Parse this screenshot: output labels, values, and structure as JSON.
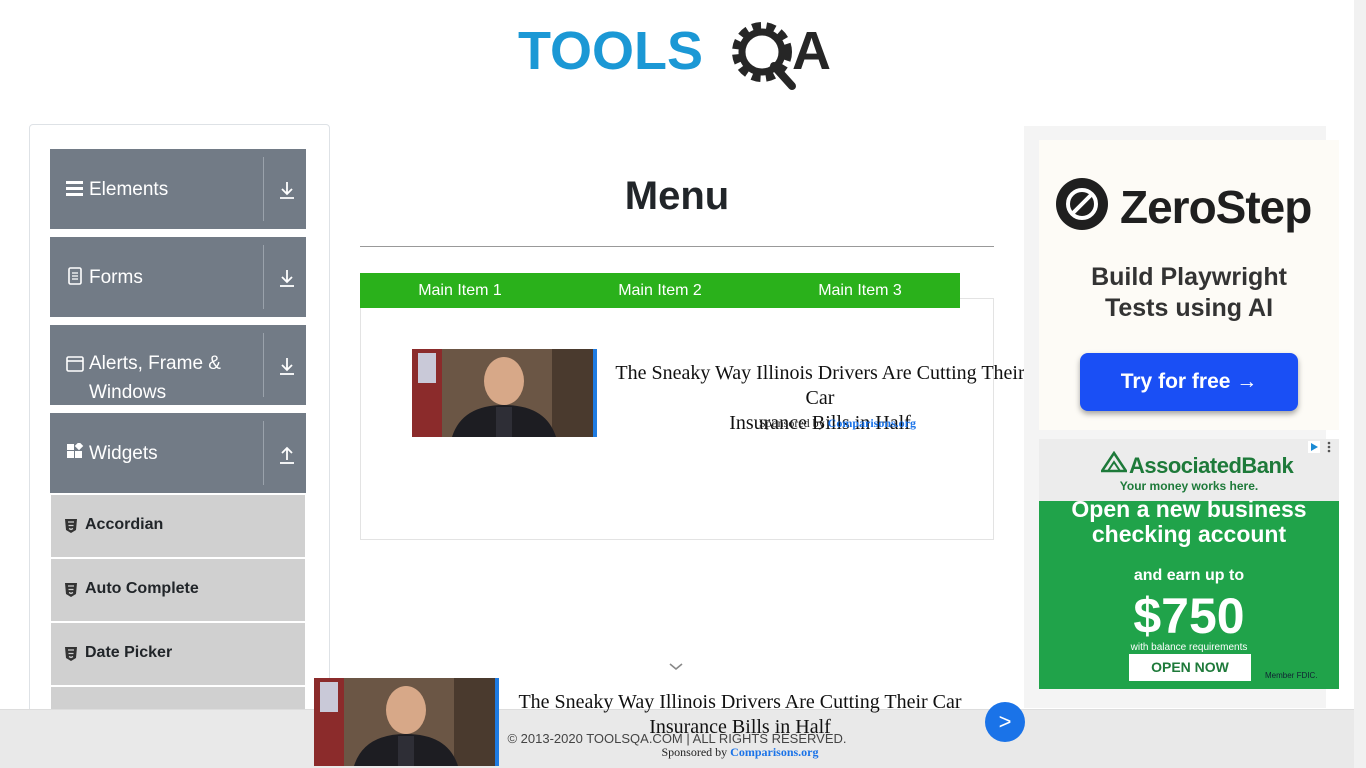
{
  "logo": {
    "text_primary": "TOOLS",
    "text_secondary": "A",
    "brand_blue": "#1b98d5",
    "brand_dark": "#262626"
  },
  "sidebar": {
    "groups": [
      {
        "label": "Elements",
        "icon": "hamburger-icon",
        "arrow": "download-icon"
      },
      {
        "label": "Forms",
        "icon": "document-icon",
        "arrow": "download-icon"
      },
      {
        "label": "Alerts, Frame &",
        "label_line2": "Windows",
        "icon": "window-icon",
        "arrow": "download-icon"
      },
      {
        "label": "Widgets",
        "icon": "widgets-icon",
        "arrow": "upload-icon"
      }
    ],
    "widget_items": [
      {
        "label": "Accordian",
        "icon": "html5-icon"
      },
      {
        "label": "Auto Complete",
        "icon": "html5-icon"
      },
      {
        "label": "Date Picker",
        "icon": "html5-icon"
      }
    ]
  },
  "main": {
    "title": "Menu",
    "nav": [
      "Main Item 1",
      "Main Item 2",
      "Main Item 3"
    ],
    "nav_color": "#2ab11b"
  },
  "ad_inline": {
    "headline_line1": "The Sneaky Way Illinois Drivers Are Cutting Their Car",
    "headline_line2": "Insurance Bills in Half",
    "sponsored_prefix": "Sponsored by",
    "sponsor": "Comparisons.org"
  },
  "ad_sticky": {
    "headline_line1": "The Sneaky Way Illinois Drivers Are Cutting Their Car",
    "headline_line2": "Insurance Bills in Half",
    "sponsored_prefix": "Sponsored by",
    "sponsor": "Comparisons.org",
    "next_label": ">"
  },
  "ad_zerostep": {
    "brand": "ZeroStep",
    "tagline_line1": "Build Playwright",
    "tagline_line2": "Tests using AI",
    "cta": "Try for free →"
  },
  "ad_associated": {
    "brand": "AssociatedBank",
    "slogan": "Your money works here.",
    "headline_line1": "Open a new business",
    "headline_line2": "checking account",
    "earn": "and earn up to",
    "amount": "$750",
    "requirement": "with balance requirements",
    "cta": "OPEN NOW",
    "fdic": "Member FDIC."
  },
  "footer": {
    "text": "© 2013-2020 TOOLSQA.COM | ALL RIGHTS RESERVED."
  }
}
